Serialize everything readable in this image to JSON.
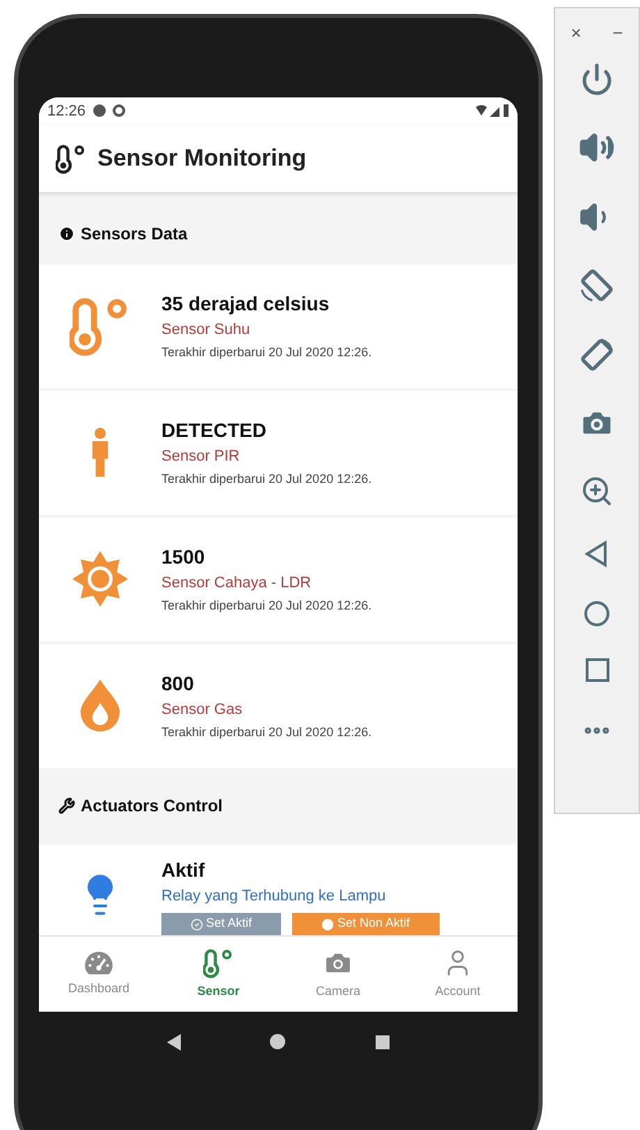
{
  "status_bar": {
    "time": "12:26"
  },
  "app_bar": {
    "title": "Sensor Monitoring"
  },
  "sensors_section": {
    "title": "Sensors Data"
  },
  "sensors": [
    {
      "kind": "temperature",
      "value": "35 derajad celsius",
      "name": "Sensor Suhu",
      "updated": "Terakhir diperbarui 20 Jul 2020 12:26."
    },
    {
      "kind": "person",
      "value": "DETECTED",
      "name": "Sensor PIR",
      "updated": "Terakhir diperbarui 20 Jul 2020 12:26."
    },
    {
      "kind": "sun",
      "value": "1500",
      "name": "Sensor Cahaya - LDR",
      "updated": "Terakhir diperbarui 20 Jul 2020 12:26."
    },
    {
      "kind": "drop",
      "value": "800",
      "name": "Sensor Gas",
      "updated": "Terakhir diperbarui 20 Jul 2020 12:26."
    }
  ],
  "actuators_section": {
    "title": "Actuators Control"
  },
  "actuators": [
    {
      "state": "Aktif",
      "on": true,
      "name": "Relay yang Terhubung ke Lampu",
      "buttons": [
        {
          "kind": "on",
          "label": "Set Aktif",
          "disabled": true
        },
        {
          "kind": "off",
          "label": "Set Non Aktif",
          "disabled": false
        }
      ]
    }
  ],
  "bottom_nav": [
    {
      "kind": "dashboard",
      "label": "Dashboard",
      "selected": false
    },
    {
      "kind": "sensor",
      "label": "Sensor",
      "selected": true
    },
    {
      "kind": "camera",
      "label": "Camera",
      "selected": false
    },
    {
      "kind": "account",
      "label": "Account",
      "selected": false
    }
  ],
  "emulator_toolbar": {
    "close": "×",
    "minimize": "−"
  }
}
